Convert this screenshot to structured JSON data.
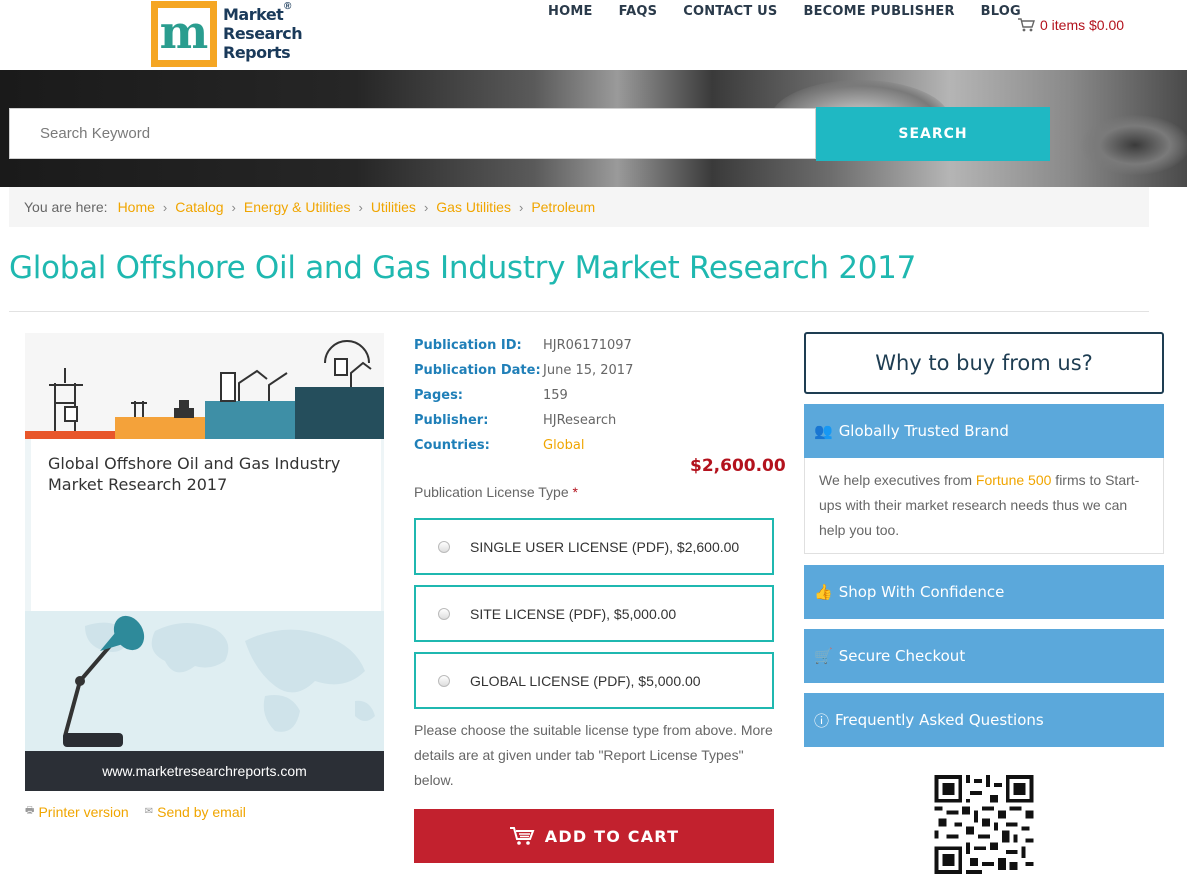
{
  "logo": {
    "line1": "Market",
    "line2": "Research",
    "line3": "Reports",
    "mark": "m",
    "reg": "®"
  },
  "nav": [
    "HOME",
    "FAQS",
    "CONTACT US",
    "BECOME PUBLISHER",
    "BLOG"
  ],
  "cart": {
    "label": "0 items $0.00",
    "icon": "cart-icon"
  },
  "search": {
    "placeholder": "Search Keyword",
    "button": "SEARCH"
  },
  "breadcrumb": {
    "label": "You are here:",
    "items": [
      "Home",
      "Catalog",
      "Energy & Utilities",
      "Utilities",
      "Gas Utilities",
      "Petroleum"
    ]
  },
  "page_title": "Global Offshore Oil and Gas Industry Market Research 2017",
  "cover": {
    "title": "Global Offshore Oil and Gas Industry Market Research 2017",
    "footer": "www.marketresearchreports.com"
  },
  "side_links": {
    "printer": "Printer version",
    "email": "Send by email"
  },
  "details": [
    {
      "k": "Publication ID:",
      "v": "HJR06171097"
    },
    {
      "k": "Publication Date:",
      "v": "June 15, 2017"
    },
    {
      "k": "Pages:",
      "v": "159"
    },
    {
      "k": "Publisher:",
      "v": "HJResearch"
    },
    {
      "k": "Countries:",
      "v": "Global"
    }
  ],
  "price": "$2,600.00",
  "license": {
    "label": "Publication License Type",
    "required": "*",
    "options": [
      "SINGLE USER LICENSE (PDF), $2,600.00",
      "SITE LICENSE (PDF), $5,000.00",
      "GLOBAL LICENSE (PDF), $5,000.00"
    ],
    "help": "Please choose the suitable license type from above. More details are at given under tab \"Report License Types\" below."
  },
  "add_to_cart": "ADD TO CART",
  "why": {
    "title": "Why to buy from us?",
    "panels": [
      {
        "title": "Globally Trusted Brand",
        "icon": "users-icon"
      },
      {
        "title": "Shop With Confidence",
        "icon": "thumbs-up-icon"
      },
      {
        "title": "Secure Checkout",
        "icon": "cart-icon"
      },
      {
        "title": "Frequently Asked Questions",
        "icon": "question-icon"
      }
    ],
    "trusted_text": {
      "pre": "We help executives from ",
      "highlight": "Fortune 500",
      "post": " firms to Start-ups with their market research needs thus we can help you too."
    }
  },
  "colors": {
    "accent": "#1fb8b0",
    "link": "#f0a500",
    "price": "#b3121d",
    "panel": "#5ba8db",
    "cart_button": "#c2212e"
  }
}
